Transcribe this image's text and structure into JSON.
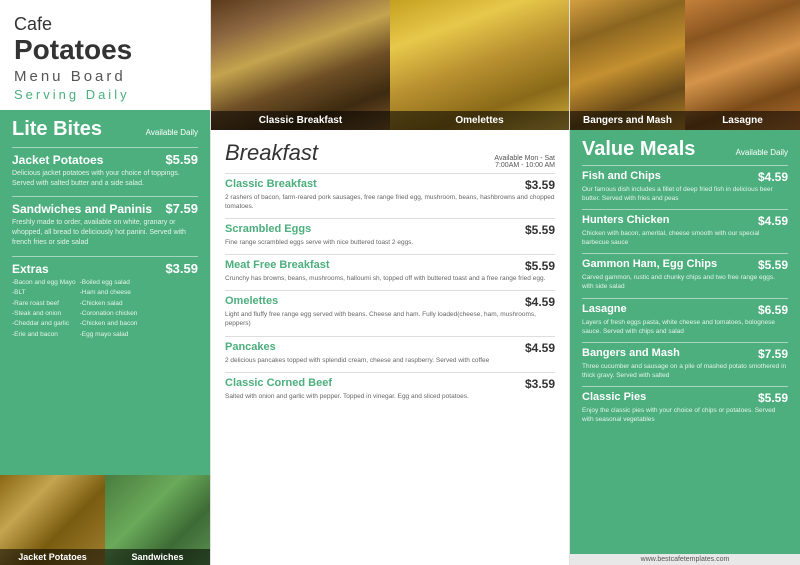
{
  "left": {
    "cafe_line1": "Cafe",
    "cafe_line2": "Potatoes",
    "cafe_line3": "Menu Board",
    "cafe_line4": "Serving Daily",
    "section_title": "Lite Bites",
    "available": "Available Daily",
    "items": [
      {
        "name": "Jacket Potatoes",
        "price": "$5.59",
        "desc": "Delicious jacket potatoes with your choice of toppings. Served with salted butter and a side salad."
      },
      {
        "name": "Sandwiches and Paninis",
        "price": "$7.59",
        "desc": "Freshly made to order, available on white, granary or whopped, all bread to deliciously hot panini. Served with french fries or side salad"
      },
      {
        "name": "Extras",
        "price": "$3.59",
        "desc": ""
      }
    ],
    "extras_col1": [
      "-Bacon and egg Mayo",
      "-BLT",
      "-Rare roast beef",
      "-Steak and onion",
      "-Cheddar and garlic",
      "-Erie and bacon"
    ],
    "extras_col2": [
      "-Boiled egg salad",
      "-Ham and cheese",
      "-Chicken salad",
      "-Coronation chicken",
      "-Chicken and bacon",
      "-Egg mayo salad"
    ],
    "bottom_images": [
      {
        "label": "Jacket Potatoes"
      },
      {
        "label": "Sandwiches"
      }
    ]
  },
  "middle": {
    "top_photos": [
      {
        "label": "Classic Breakfast"
      },
      {
        "label": "Omelettes"
      }
    ],
    "section_title": "Breakfast",
    "available": "Available Mon - Sat",
    "time": "7:00AM - 10:00 AM",
    "items": [
      {
        "name": "Classic Breakfast",
        "price": "$3.59",
        "desc": "2 rashers of bacon, farm-reared pork sausages, free range fried egg, mushroom, beans, hashbrowns and chopped tomatoes."
      },
      {
        "name": "Scrambled Eggs",
        "price": "$5.59",
        "desc": "Fine range scrambled eggs serve with nice buttered toast 2 eggs."
      },
      {
        "name": "Meat Free Breakfast",
        "price": "$5.59",
        "desc": "Crunchy has browns, beans, mushrooms, halloumi sh, topped off with buttered toast and a free range fried egg."
      },
      {
        "name": "Omelettes",
        "price": "$4.59",
        "desc": "Light and fluffy free range egg served with beans. Cheese and ham. Fully loaded(cheese, ham, mushrooms, peppers)"
      },
      {
        "name": "Pancakes",
        "price": "$4.59",
        "desc": "2 delicious pancakes topped with splendid cream, cheese and raspberry. Served with coffee"
      },
      {
        "name": "Classic Corned Beef",
        "price": "$3.59",
        "desc": "Salted with onion and garlic with pepper. Topped in vinegar. Egg and sliced potatoes."
      }
    ]
  },
  "right": {
    "top_photos": [
      {
        "label": "Bangers and Mash"
      },
      {
        "label": "Lasagne"
      }
    ],
    "section_title": "Value Meals",
    "available": "Available Daily",
    "items": [
      {
        "name": "Fish and Chips",
        "price": "$4.59",
        "desc": "Our famous dish includes a fillet of deep fried fish in delicious beer butter. Served with fries and peas"
      },
      {
        "name": "Hunters Chicken",
        "price": "$4.59",
        "desc": "Chicken with bacon, amerital, cheese smooth with our special barbecue sauce"
      },
      {
        "name": "Gammon Ham, Egg Chips",
        "price": "$5.59",
        "desc": "Carved gammon, rustic and chunky chips and two free range eggs. with side salad"
      },
      {
        "name": "Lasagne",
        "price": "$6.59",
        "desc": "Layers of fresh eggs pasta, white cheese and tomatoes, bolognese sauce. Served with chips and salad"
      },
      {
        "name": "Bangers and Mash",
        "price": "$7.59",
        "desc": "Three cucumber and sausage on a pile of mashed potato smothered in thick gravy. Served with salted"
      },
      {
        "name": "Classic Pies",
        "price": "$5.59",
        "desc": "Enjoy the classic pies with your choice of chips or potatoes. Served with seasonal vegetables"
      }
    ],
    "website": "www.bestcafetemplates.com"
  }
}
